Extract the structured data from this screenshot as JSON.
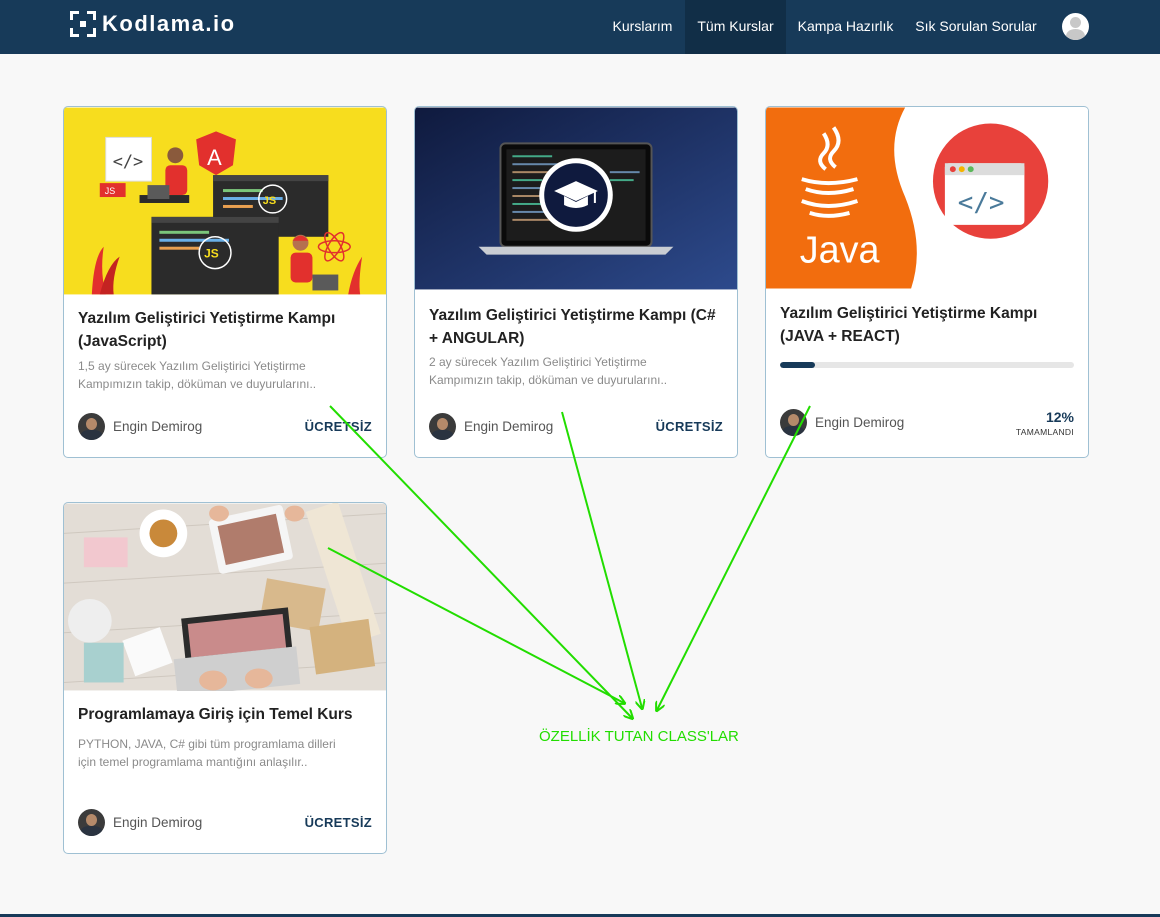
{
  "navbar": {
    "logo_text": "Kodlama.io",
    "items": [
      {
        "label": "Kurslarım",
        "active": false
      },
      {
        "label": "Tüm Kurslar",
        "active": true
      },
      {
        "label": "Kampa Hazırlık",
        "active": false
      },
      {
        "label": "Sık Sorulan Sorular",
        "active": false
      }
    ],
    "avatar_icon": "user-avatar-icon"
  },
  "cards": [
    {
      "title": "Yazılım Geliştirici Yetiştirme Kampı (JavaScript)",
      "description": "1,5 ay sürecek Yazılım Geliştirici Yetiştirme Kampımızın takip, döküman ve duyurularını..",
      "author": "Engin Demirog",
      "price": "ÜCRETSİZ"
    },
    {
      "title": "Yazılım Geliştirici Yetiştirme Kampı (C# + ANGULAR)",
      "description": "2 ay sürecek Yazılım Geliştirici Yetiştirme Kampımızın takip, döküman ve duyurularını..",
      "author": "Engin Demirog",
      "price": "ÜCRETSİZ"
    },
    {
      "title": "Yazılım Geliştirici Yetiştirme Kampı (JAVA + REACT)",
      "author": "Engin Demirog",
      "progress_percent": 12,
      "progress_text": "12%",
      "progress_label": "TAMAMLANDI"
    },
    {
      "title": "Programlamaya Giriş için Temel Kurs",
      "description": "PYTHON, JAVA, C# gibi tüm programlama dilleri için temel programlama mantığını anlaşılır..",
      "author": "Engin Demirog",
      "price": "ÜCRETSİZ"
    }
  ],
  "images": {
    "js_tags": [
      "JS",
      "JS",
      "JS"
    ],
    "angular_letter": "A",
    "java_word": "Java"
  },
  "annotation": {
    "label": "ÖZELLİK TUTAN CLASS'LAR",
    "color": "#22dd00"
  },
  "colors": {
    "navbar": "#173a59",
    "navbar_active": "#112e47",
    "js_bg": "#f7dd1e",
    "java_orange": "#f26d0e",
    "code_red": "#e8413b"
  }
}
